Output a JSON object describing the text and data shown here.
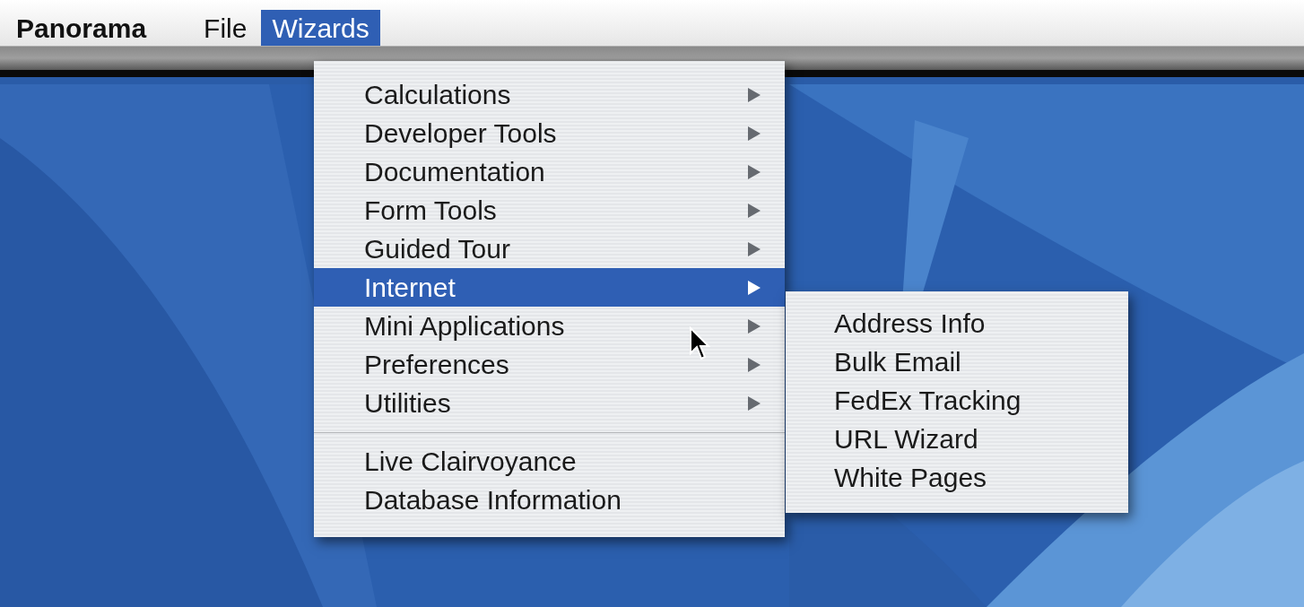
{
  "menu_bar": [
    {
      "label": "Panorama",
      "kind": "app",
      "selected": false
    },
    {
      "label": "File",
      "kind": "menu",
      "selected": false
    },
    {
      "label": "Wizards",
      "kind": "menu",
      "selected": true
    }
  ],
  "wizards_menu": [
    {
      "label": "Calculations",
      "kind": "submenu",
      "selected": false
    },
    {
      "label": "Developer Tools",
      "kind": "submenu",
      "selected": false
    },
    {
      "label": "Documentation",
      "kind": "submenu",
      "selected": false
    },
    {
      "label": "Form Tools",
      "kind": "submenu",
      "selected": false
    },
    {
      "label": "Guided Tour",
      "kind": "submenu",
      "selected": false
    },
    {
      "label": "Internet",
      "kind": "submenu",
      "selected": true
    },
    {
      "label": "Mini Applications",
      "kind": "submenu",
      "selected": false
    },
    {
      "label": "Preferences",
      "kind": "submenu",
      "selected": false
    },
    {
      "label": "Utilities",
      "kind": "submenu",
      "selected": false
    },
    {
      "kind": "separator"
    },
    {
      "label": "Live Clairvoyance",
      "kind": "action",
      "selected": false
    },
    {
      "label": "Database Information",
      "kind": "action",
      "selected": false
    }
  ],
  "internet_submenu": [
    {
      "label": "Address Info",
      "selected": false
    },
    {
      "label": "Bulk Email",
      "selected": false
    },
    {
      "label": "FedEx Tracking",
      "selected": false
    },
    {
      "label": "URL Wizard",
      "selected": false
    },
    {
      "label": "White Pages",
      "selected": false
    }
  ]
}
